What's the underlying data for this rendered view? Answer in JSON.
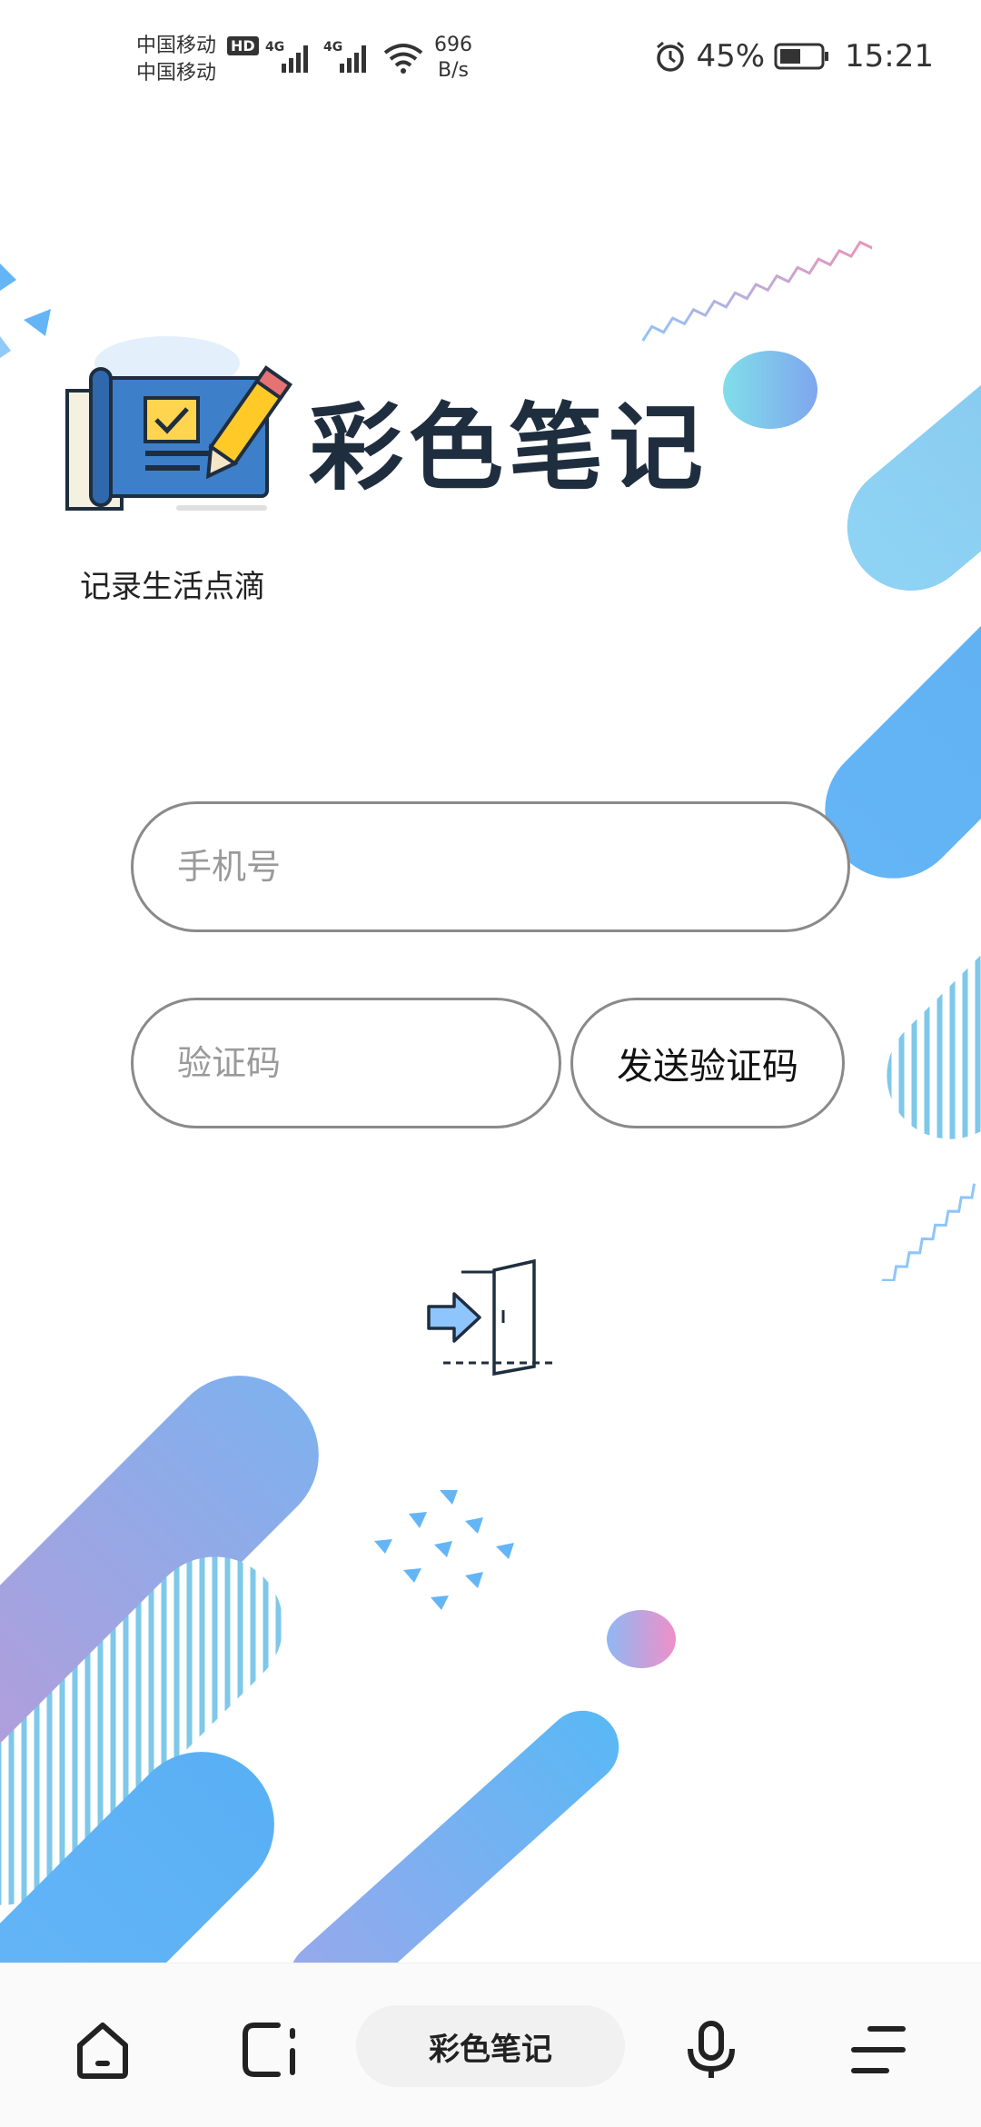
{
  "status_bar": {
    "carrier_1": "中国移动",
    "carrier_2": "中国移动",
    "hd_badge": "HD",
    "signal_1_label": "4G",
    "signal_2_label": "4G",
    "net_speed_value": "696",
    "net_speed_unit": "B/s",
    "battery_percent": "45%",
    "time": "15:21",
    "icons": [
      "signal-icon",
      "wifi-icon",
      "alarm-icon",
      "battery-icon"
    ]
  },
  "header": {
    "app_title": "彩色笔记",
    "subtitle": "记录生活点滴"
  },
  "form": {
    "phone_placeholder": "手机号",
    "code_placeholder": "验证码",
    "send_code_label": "发送验证码",
    "login_icon": "login-door-icon"
  },
  "bottom_nav": {
    "center_label": "彩色笔记",
    "icons": [
      "home-icon",
      "tabs-icon",
      "microphone-icon",
      "menu-icon"
    ]
  },
  "colors": {
    "accent_blue": "#64b5f6",
    "accent_purple": "#b39ddb",
    "title_dark": "#1f2e3f",
    "border_gray": "#8a8a8a"
  }
}
